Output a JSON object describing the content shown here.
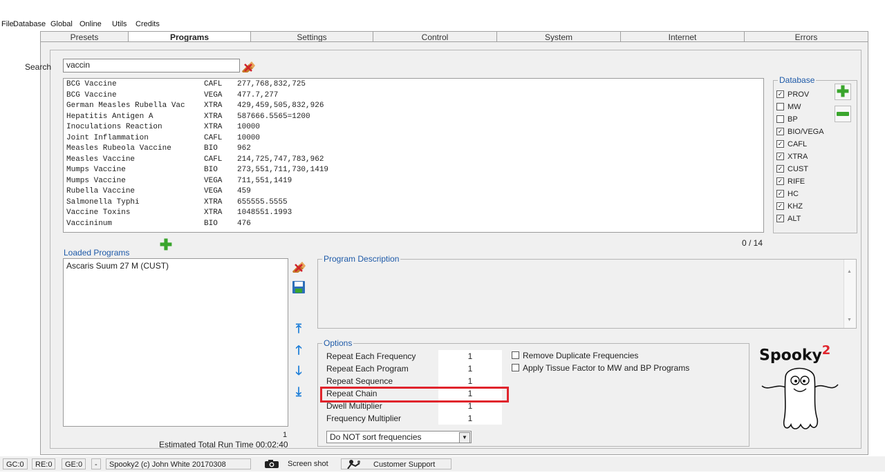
{
  "menu": [
    "File",
    "Database",
    "Global",
    "Online",
    "Utils",
    "Credits"
  ],
  "tabs": [
    "Presets",
    "Programs",
    "Settings",
    "Control",
    "System",
    "Internet",
    "Errors"
  ],
  "search": {
    "label": "Search",
    "value": "vaccin"
  },
  "programs": [
    {
      "name": "BCG Vaccine",
      "db": "CAFL",
      "freq": "277,768,832,725"
    },
    {
      "name": "BCG Vaccine",
      "db": "VEGA",
      "freq": "477.7,277"
    },
    {
      "name": "German Measles Rubella Vac",
      "db": "XTRA",
      "freq": "429,459,505,832,926"
    },
    {
      "name": "Hepatitis Antigen A",
      "db": "XTRA",
      "freq": "587666.5565=1200"
    },
    {
      "name": "Inoculations Reaction",
      "db": "XTRA",
      "freq": "10000"
    },
    {
      "name": "Joint Inflammation",
      "db": "CAFL",
      "freq": "10000"
    },
    {
      "name": "Measles Rubeola Vaccine",
      "db": "BIO",
      "freq": "962"
    },
    {
      "name": "Measles Vaccine",
      "db": "CAFL",
      "freq": "214,725,747,783,962"
    },
    {
      "name": "Mumps Vaccine",
      "db": "BIO",
      "freq": "273,551,711,730,1419"
    },
    {
      "name": "Mumps Vaccine",
      "db": "VEGA",
      "freq": "711,551,1419"
    },
    {
      "name": "Rubella Vaccine",
      "db": "VEGA",
      "freq": "459"
    },
    {
      "name": "Salmonella Typhi",
      "db": "XTRA",
      "freq": "655555.5555"
    },
    {
      "name": "Vaccine Toxins",
      "db": "XTRA",
      "freq": "1048551.1993"
    },
    {
      "name": "Vaccininum",
      "db": "BIO",
      "freq": "476"
    }
  ],
  "database": {
    "title": "Database",
    "items": [
      {
        "label": "PROV",
        "checked": true
      },
      {
        "label": "MW",
        "checked": false
      },
      {
        "label": "BP",
        "checked": false
      },
      {
        "label": "BIO/VEGA",
        "checked": true
      },
      {
        "label": "CAFL",
        "checked": true
      },
      {
        "label": "XTRA",
        "checked": true
      },
      {
        "label": "CUST",
        "checked": true
      },
      {
        "label": "RIFE",
        "checked": true
      },
      {
        "label": "HC",
        "checked": true
      },
      {
        "label": "KHZ",
        "checked": true
      },
      {
        "label": "ALT",
        "checked": true
      }
    ]
  },
  "count": "0 / 14",
  "loaded": {
    "title": "Loaded Programs",
    "items": [
      "Ascaris Suum 27 M (CUST)"
    ],
    "count": "1",
    "runtime": "Estimated Total Run Time 00:02:40"
  },
  "description": {
    "title": "Program Description"
  },
  "options": {
    "title": "Options",
    "rows": [
      {
        "label": "Repeat Each Frequency",
        "value": "1"
      },
      {
        "label": "Repeat Each Program",
        "value": "1"
      },
      {
        "label": "Repeat Sequence",
        "value": "1"
      },
      {
        "label": "Repeat Chain",
        "value": "1"
      },
      {
        "label": "Dwell Multiplier",
        "value": "1"
      },
      {
        "label": "Frequency Multiplier",
        "value": "1"
      }
    ],
    "checks": [
      {
        "label": "Remove Duplicate Frequencies",
        "checked": false
      },
      {
        "label": "Apply Tissue Factor to MW and BP Programs",
        "checked": false
      }
    ],
    "sort": "Do NOT sort frequencies"
  },
  "logo": {
    "text": "Spooky",
    "sup": "2"
  },
  "status": {
    "gc": "GC:0",
    "re": "RE:0",
    "ge": "GE:0",
    "dash": "-",
    "copyright": "Spooky2 (c) John White 20170308",
    "screenshot": "Screen shot",
    "support": "Customer Support"
  },
  "colors": {
    "accent_blue": "#1e5aa8",
    "green": "#3aa52d",
    "highlight_red": "#e0242c"
  }
}
